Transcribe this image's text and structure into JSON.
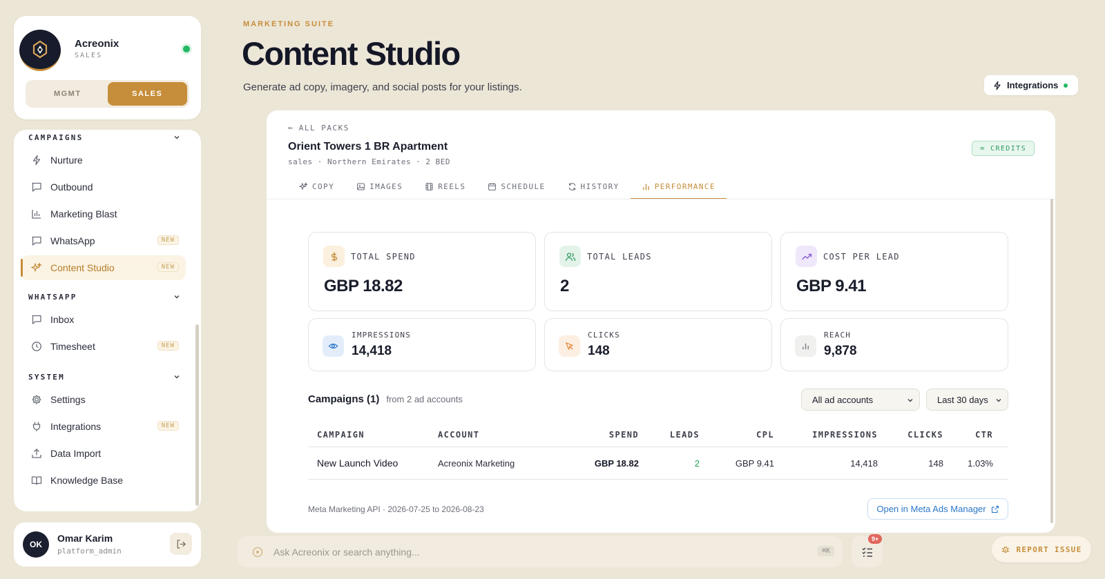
{
  "brand": {
    "name": "Acreonix",
    "subtitle": "SALES",
    "modes": [
      "MGMT",
      "SALES"
    ],
    "active_mode": "SALES"
  },
  "sidebar": {
    "sections": [
      {
        "title": "CAMPAIGNS",
        "items": [
          {
            "label": "Nurture",
            "icon": "lightning-icon",
            "badge": ""
          },
          {
            "label": "Outbound",
            "icon": "message-icon",
            "badge": ""
          },
          {
            "label": "Marketing Blast",
            "icon": "bar-chart-icon",
            "badge": ""
          },
          {
            "label": "WhatsApp",
            "icon": "message-icon",
            "badge": "NEW"
          },
          {
            "label": "Content Studio",
            "icon": "sparkles-icon",
            "badge": "NEW",
            "active": true
          }
        ]
      },
      {
        "title": "WHATSAPP",
        "items": [
          {
            "label": "Inbox",
            "icon": "message-icon",
            "badge": ""
          },
          {
            "label": "Timesheet",
            "icon": "clock-icon",
            "badge": "NEW"
          }
        ]
      },
      {
        "title": "SYSTEM",
        "items": [
          {
            "label": "Settings",
            "icon": "gear-icon",
            "badge": ""
          },
          {
            "label": "Integrations",
            "icon": "plug-icon",
            "badge": "NEW"
          },
          {
            "label": "Data Import",
            "icon": "upload-icon",
            "badge": ""
          },
          {
            "label": "Knowledge Base",
            "icon": "book-icon",
            "badge": ""
          }
        ]
      }
    ]
  },
  "user": {
    "initials": "OK",
    "name": "Omar Karim",
    "role": "platform_admin"
  },
  "header": {
    "eyebrow": "MARKETING SUITE",
    "title": "Content Studio",
    "subtitle": "Generate ad copy, imagery, and social posts for your listings.",
    "integrations_label": "Integrations"
  },
  "pack": {
    "back_label": "ALL PACKS",
    "title": "Orient Towers 1 BR Apartment",
    "meta": "sales · Northern Emirates · 2 BED",
    "credits_label": "∞ CREDITS"
  },
  "tabs": [
    {
      "label": "COPY",
      "icon": "sparkles-icon"
    },
    {
      "label": "IMAGES",
      "icon": "image-icon"
    },
    {
      "label": "REELS",
      "icon": "film-icon"
    },
    {
      "label": "SCHEDULE",
      "icon": "calendar-icon"
    },
    {
      "label": "HISTORY",
      "icon": "refresh-icon"
    },
    {
      "label": "PERFORMANCE",
      "icon": "bar-chart-icon",
      "active": true
    }
  ],
  "metrics": {
    "total_spend": {
      "label": "TOTAL SPEND",
      "value": "GBP 18.82"
    },
    "total_leads": {
      "label": "TOTAL LEADS",
      "value": "2"
    },
    "cost_per_lead": {
      "label": "COST PER LEAD",
      "value": "GBP 9.41"
    },
    "impressions": {
      "label": "IMPRESSIONS",
      "value": "14,418"
    },
    "clicks": {
      "label": "CLICKS",
      "value": "148"
    },
    "reach": {
      "label": "REACH",
      "value": "9,878"
    }
  },
  "campaigns": {
    "title": "Campaigns (1)",
    "subtitle": "from 2 ad accounts",
    "account_filter": "All ad accounts",
    "date_filter": "Last 30 days",
    "columns": [
      "CAMPAIGN",
      "ACCOUNT",
      "SPEND",
      "LEADS",
      "CPL",
      "IMPRESSIONS",
      "CLICKS",
      "CTR"
    ],
    "rows": [
      {
        "campaign": "New Launch Video",
        "account": "Acreonix Marketing",
        "spend": "GBP 18.82",
        "leads": "2",
        "cpl": "GBP 9.41",
        "impressions": "14,418",
        "clicks": "148",
        "ctr": "1.03%"
      }
    ],
    "source_note": "Meta Marketing API · 2026-07-25 to 2026-08-23",
    "open_meta_label": "Open in Meta Ads Manager"
  },
  "bottom": {
    "ask_placeholder": "Ask Acreonix or search anything...",
    "kbd_hint": "⌘K",
    "tasks_badge": "9+",
    "report_label": "REPORT ISSUE"
  },
  "colors": {
    "accent": "#c68d3a",
    "background": "#ece6d7",
    "success": "#22b864",
    "link": "#2c77c9"
  }
}
